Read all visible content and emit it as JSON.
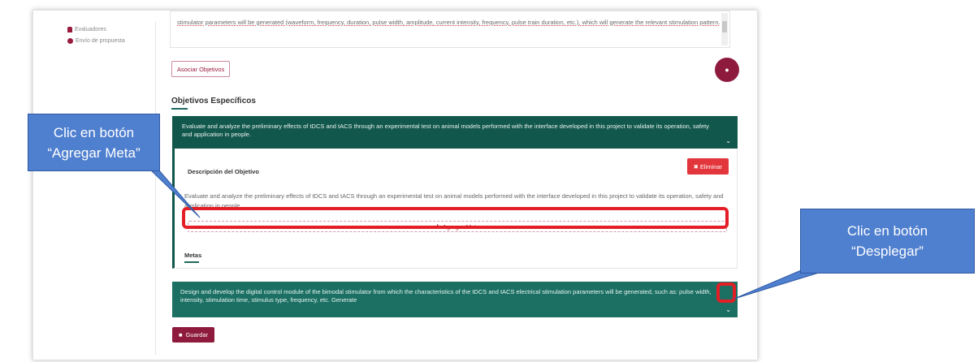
{
  "nav": {
    "items": [
      {
        "label": "Evaluadores",
        "icon": "user-icon"
      },
      {
        "label": "Envío de propuesta",
        "icon": "check-circle-icon"
      }
    ]
  },
  "textarea": {
    "value": "stimulator parameters will be generated (waveform, frequency, duration, pulse width, amplitude, current intensity, frequency, pulse train duration, etc.), which will generate the relevant stimulation pattern."
  },
  "buttons": {
    "associate": "Asociar Objetivos",
    "eye_icon": "eye-icon",
    "delete": "Eliminar",
    "add_meta": "Agregar Meta",
    "save": "Guardar"
  },
  "section": {
    "title": "Objetivos Específicos"
  },
  "objectives": [
    {
      "header": "Evaluate and analyze the preliminary effects of tDCS and tACS through an experimental test on animal models performed with the interface developed in this project to validate its operation, safety and application in people.",
      "description_label": "Descripción del Objetivo",
      "description": "Evaluate and analyze the preliminary effects of tDCS and tACS through an experimental test on animal models performed with the interface developed in this project to validate its operation, safety and application in people.",
      "metas_label": "Metas"
    },
    {
      "header": "Design and develop the digital control module of the bimodal stimulator from which the characteristics of the tDCS and tACS electrical stimulation parameters will be generated, such as: pulse width, intensity, stimulation time, stimulus type, frequency, etc. Generate"
    }
  ],
  "annotations": {
    "left_line1": "Clic en botón",
    "left_line2": "“Agregar Meta”",
    "right_line1": "Clic en botón",
    "right_line2": "“Desplegar”"
  },
  "colors": {
    "primary": "#8e1b3e",
    "teal": "#12574c",
    "danger": "#e2363c",
    "callout": "#4f7fcf",
    "highlight": "#e41e26"
  }
}
